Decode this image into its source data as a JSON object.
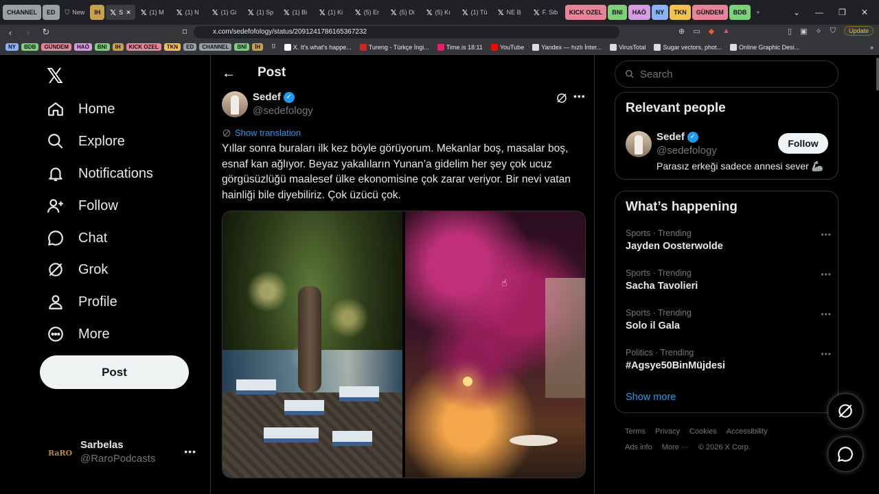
{
  "browser": {
    "tabs": [
      {
        "label": "CHANNEL",
        "type": "group",
        "color": "#9aa0a6"
      },
      {
        "label": "ED",
        "type": "group",
        "color": "#9aa0a6"
      },
      {
        "label": "New",
        "type": "tab"
      },
      {
        "label": "IH",
        "type": "group",
        "color": "#c9a24b"
      },
      {
        "label": "S",
        "type": "active"
      },
      {
        "label": "(1) M",
        "type": "x"
      },
      {
        "label": "(1) N",
        "type": "x"
      },
      {
        "label": "(1) Gi",
        "type": "x"
      },
      {
        "label": "(1) Sp",
        "type": "x"
      },
      {
        "label": "(1) Bi",
        "type": "x"
      },
      {
        "label": "(1) Ki",
        "type": "x"
      },
      {
        "label": "(5) Er",
        "type": "x"
      },
      {
        "label": "(5) Di",
        "type": "x"
      },
      {
        "label": "(5) Kı",
        "type": "x"
      },
      {
        "label": "(1) Tü",
        "type": "x"
      },
      {
        "label": "NE B",
        "type": "x"
      },
      {
        "label": "F. Sib",
        "type": "x"
      },
      {
        "label": "KICK OZEL",
        "type": "group",
        "color": "#e8849a"
      },
      {
        "label": "BNI",
        "type": "group",
        "color": "#7fd07a"
      },
      {
        "label": "HAÖ",
        "type": "group",
        "color": "#d79be0"
      },
      {
        "label": "NY",
        "type": "group",
        "color": "#8ab4f8"
      },
      {
        "label": "TKN",
        "type": "group",
        "color": "#f2c14e"
      },
      {
        "label": "GÜNDEM",
        "type": "group",
        "color": "#e8849a"
      },
      {
        "label": "BDB",
        "type": "group",
        "color": "#7fd07a"
      }
    ],
    "url": "x.com/sedefofology/status/2091241786165367232",
    "update_label": "Update",
    "bookmark_chips": [
      {
        "label": "NY",
        "color": "#8ab4f8"
      },
      {
        "label": "BDB",
        "color": "#7fd07a"
      },
      {
        "label": "GÜNDEM",
        "color": "#e8849a"
      },
      {
        "label": "HAÖ",
        "color": "#d79be0"
      },
      {
        "label": "BNI",
        "color": "#7fd07a"
      },
      {
        "label": "IH",
        "color": "#c9a24b"
      },
      {
        "label": "KICK OZEL",
        "color": "#e8849a"
      },
      {
        "label": "TKN",
        "color": "#f2c14e"
      },
      {
        "label": "ED",
        "color": "#9aa0a6"
      },
      {
        "label": "CHANNEL",
        "color": "#9aa0a6"
      },
      {
        "label": "BNİ",
        "color": "#7fd07a"
      },
      {
        "label": "İH",
        "color": "#c9a24b"
      }
    ],
    "bookmarks": [
      {
        "label": "X. It's what's happe...",
        "color": "#ffffff"
      },
      {
        "label": "Tureng - Türkçe İngi...",
        "color": "#c62828"
      },
      {
        "label": "Time.is 18:11",
        "color": "#e91e63"
      },
      {
        "label": "YouTube",
        "color": "#ff0000"
      },
      {
        "label": "Yandex — hızlı İnter...",
        "color": "#dddddd"
      },
      {
        "label": "VirusTotal",
        "color": "#dddddd"
      },
      {
        "label": "Sugar vectors, phot...",
        "color": "#dddddd"
      },
      {
        "label": "Online Graphic Desi...",
        "color": "#dddddd"
      }
    ]
  },
  "sidebar": {
    "items": [
      {
        "label": "Home",
        "icon": "home-icon"
      },
      {
        "label": "Explore",
        "icon": "search-icon"
      },
      {
        "label": "Notifications",
        "icon": "bell-icon"
      },
      {
        "label": "Follow",
        "icon": "add-person-icon"
      },
      {
        "label": "Chat",
        "icon": "chat-icon"
      },
      {
        "label": "Grok",
        "icon": "grok-icon"
      },
      {
        "label": "Profile",
        "icon": "person-icon"
      },
      {
        "label": "More",
        "icon": "more-circle-icon"
      }
    ],
    "post_label": "Post",
    "account": {
      "name": "Sarbelas",
      "handle": "@RaroPodcasts",
      "avatar_text": "RaRO"
    }
  },
  "main": {
    "title": "Post",
    "author": {
      "name": "Sedef",
      "handle": "@sedefology"
    },
    "show_translation": "Show translation",
    "text": "Yıllar sonra buraları ilk kez böyle görüyorum. Mekanlar boş, masalar boş, esnaf kan ağlıyor. Beyaz yakalıların Yunan’a gidelim her şey çok ucuz görgüsüzlüğü maalesef ülke ekonomisine çok zarar veriyor. Bir nevi vatan hainliği bile diyebiliriz. Çok üzücü çok."
  },
  "right": {
    "search_placeholder": "Search",
    "relevant": {
      "title": "Relevant people",
      "name": "Sedef",
      "handle": "@sedefology",
      "bio": "Parasız erkeği sadece annesi sever 🦾",
      "follow_label": "Follow"
    },
    "happening": {
      "title": "What’s happening",
      "trends": [
        {
          "meta": "Sports · Trending",
          "topic": "Jayden Oosterwolde"
        },
        {
          "meta": "Sports · Trending",
          "topic": "Sacha Tavolieri"
        },
        {
          "meta": "Sports · Trending",
          "topic": "Solo il Gala"
        },
        {
          "meta": "Politics · Trending",
          "topic": "#Agsye50BinMüjdesi"
        }
      ],
      "show_more": "Show more"
    },
    "footer": {
      "links1": [
        "Terms",
        "Privacy",
        "Cookies",
        "Accessibility"
      ],
      "links2": [
        "Ads info",
        "More ···",
        "© 2026 X Corp."
      ]
    }
  }
}
